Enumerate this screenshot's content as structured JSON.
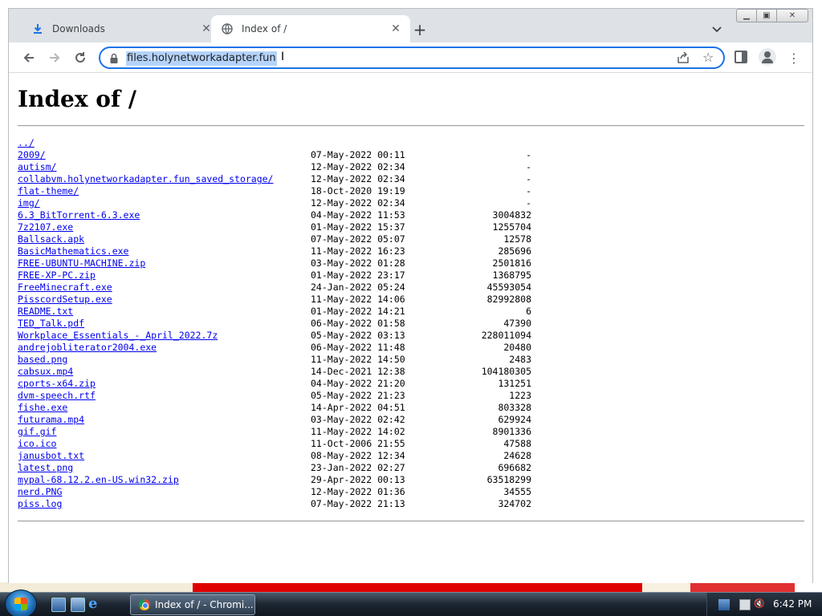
{
  "browser": {
    "tabs": [
      {
        "title": "Downloads",
        "icon": "download-icon",
        "active": false
      },
      {
        "title": "Index of /",
        "icon": "globe-icon",
        "active": true
      }
    ],
    "new_tab_label": "+",
    "address": "files.holynetworkadapter.fun"
  },
  "page": {
    "heading": "Index of /",
    "entries": [
      {
        "name": "../",
        "date": "",
        "size": ""
      },
      {
        "name": "2009/",
        "date": "07-May-2022 00:11",
        "size": "-"
      },
      {
        "name": "autism/",
        "date": "12-May-2022 02:34",
        "size": "-"
      },
      {
        "name": "collabvm.holynetworkadapter.fun_saved_storage/",
        "date": "12-May-2022 02:34",
        "size": "-"
      },
      {
        "name": "flat-theme/",
        "date": "18-Oct-2020 19:19",
        "size": "-"
      },
      {
        "name": "img/",
        "date": "12-May-2022 02:34",
        "size": "-"
      },
      {
        "name": "6.3_BitTorrent-6.3.exe",
        "date": "04-May-2022 11:53",
        "size": "3004832"
      },
      {
        "name": "7z2107.exe",
        "date": "01-May-2022 15:37",
        "size": "1255704"
      },
      {
        "name": "Ballsack.apk",
        "date": "07-May-2022 05:07",
        "size": "12578"
      },
      {
        "name": "BasicMathematics.exe",
        "date": "11-May-2022 16:23",
        "size": "285696"
      },
      {
        "name": "FREE-UBUNTU-MACHINE.zip",
        "date": "03-May-2022 01:28",
        "size": "2501816"
      },
      {
        "name": "FREE-XP-PC.zip",
        "date": "01-May-2022 23:17",
        "size": "1368795"
      },
      {
        "name": "FreeMinecraft.exe",
        "date": "24-Jan-2022 05:24",
        "size": "45593054"
      },
      {
        "name": "PisscordSetup.exe",
        "date": "11-May-2022 14:06",
        "size": "82992808"
      },
      {
        "name": "README.txt",
        "date": "01-May-2022 14:21",
        "size": "6"
      },
      {
        "name": "TED_Talk.pdf",
        "date": "06-May-2022 01:58",
        "size": "47390"
      },
      {
        "name": "Workplace_Essentials_-_April_2022.7z",
        "date": "05-May-2022 03:13",
        "size": "228011094"
      },
      {
        "name": "andrejobliterator2004.exe",
        "date": "06-May-2022 11:48",
        "size": "20480"
      },
      {
        "name": "based.png",
        "date": "11-May-2022 14:50",
        "size": "2483"
      },
      {
        "name": "cabsux.mp4",
        "date": "14-Dec-2021 12:38",
        "size": "104180305"
      },
      {
        "name": "cports-x64.zip",
        "date": "04-May-2022 21:20",
        "size": "131251"
      },
      {
        "name": "dvm-speech.rtf",
        "date": "05-May-2022 21:23",
        "size": "1223"
      },
      {
        "name": "fishe.exe",
        "date": "14-Apr-2022 04:51",
        "size": "803328"
      },
      {
        "name": "futurama.mp4",
        "date": "03-May-2022 02:42",
        "size": "629924"
      },
      {
        "name": "gif.gif",
        "date": "11-May-2022 14:02",
        "size": "8901336"
      },
      {
        "name": "ico.ico",
        "date": "11-Oct-2006 21:55",
        "size": "47588"
      },
      {
        "name": "janusbot.txt",
        "date": "08-May-2022 12:34",
        "size": "24628"
      },
      {
        "name": "latest.png",
        "date": "23-Jan-2022 02:27",
        "size": "696682"
      },
      {
        "name": "mypal-68.12.2.en-US.win32.zip",
        "date": "29-Apr-2022 00:13",
        "size": "63518299"
      },
      {
        "name": "nerd.PNG",
        "date": "12-May-2022 01:36",
        "size": "34555"
      },
      {
        "name": "piss.log",
        "date": "07-May-2022 21:13",
        "size": "324702"
      }
    ]
  },
  "taskbar": {
    "task_label": "Index of / - Chromi...",
    "clock": "6:42 PM"
  },
  "colors": {
    "link": "#0000ee",
    "omnibox_focus": "#1a73e8",
    "selection": "#b4d3fb"
  }
}
